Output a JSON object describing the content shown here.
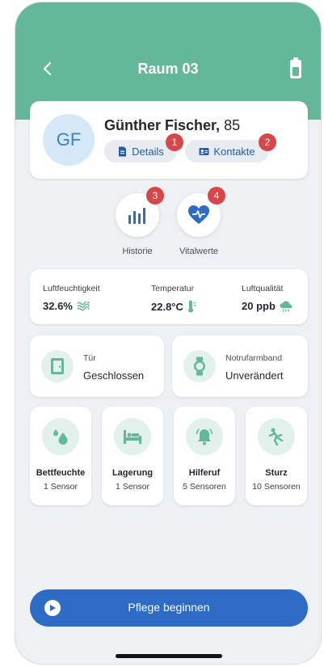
{
  "header": {
    "title": "Raum 03",
    "back_icon": "chevron-left-icon",
    "battery_icon": "battery-icon",
    "color": "#63b89a"
  },
  "patient": {
    "initials": "GF",
    "name": "Günther Fischer,",
    "age": "85",
    "buttons": [
      {
        "label": "Details",
        "icon": "document-icon",
        "badge": "1"
      },
      {
        "label": "Kontakte",
        "icon": "contact-card-icon",
        "badge": "2"
      }
    ]
  },
  "actions": [
    {
      "label": "Historie",
      "icon": "bar-chart-icon",
      "badge": "3"
    },
    {
      "label": "Vitalwerte",
      "icon": "heart-pulse-icon",
      "badge": "4"
    }
  ],
  "environment": [
    {
      "label": "Luftfeuchtigkeit",
      "value": "32.6%",
      "icon": "humidity-icon"
    },
    {
      "label": "Temperatur",
      "value": "22.8°C",
      "icon": "thermometer-icon"
    },
    {
      "label": "Luftqualität",
      "value": "20 ppb",
      "icon": "cloud-rain-icon"
    }
  ],
  "status": [
    {
      "label": "Tür",
      "value": "Geschlossen",
      "icon": "door-icon"
    },
    {
      "label": "Notrufarmband",
      "value": "Unverändert",
      "icon": "watch-icon"
    }
  ],
  "sensors": [
    {
      "name": "Bettfeuchte",
      "count": "1 Sensor",
      "icon": "water-drops-icon"
    },
    {
      "name": "Lagerung",
      "count": "1 Sensor",
      "icon": "bed-icon"
    },
    {
      "name": "Hilferuf",
      "count": "5 Sensoren",
      "icon": "bell-alarm-icon"
    },
    {
      "name": "Sturz",
      "count": "10 Sensoren",
      "icon": "fall-person-icon"
    }
  ],
  "cta": {
    "label": "Pflege beginnen",
    "icon": "play-icon",
    "color": "#2e6bc4"
  },
  "colors": {
    "accent": "#63b89a",
    "badge": "#d7474a",
    "link": "#1d5fb0"
  }
}
